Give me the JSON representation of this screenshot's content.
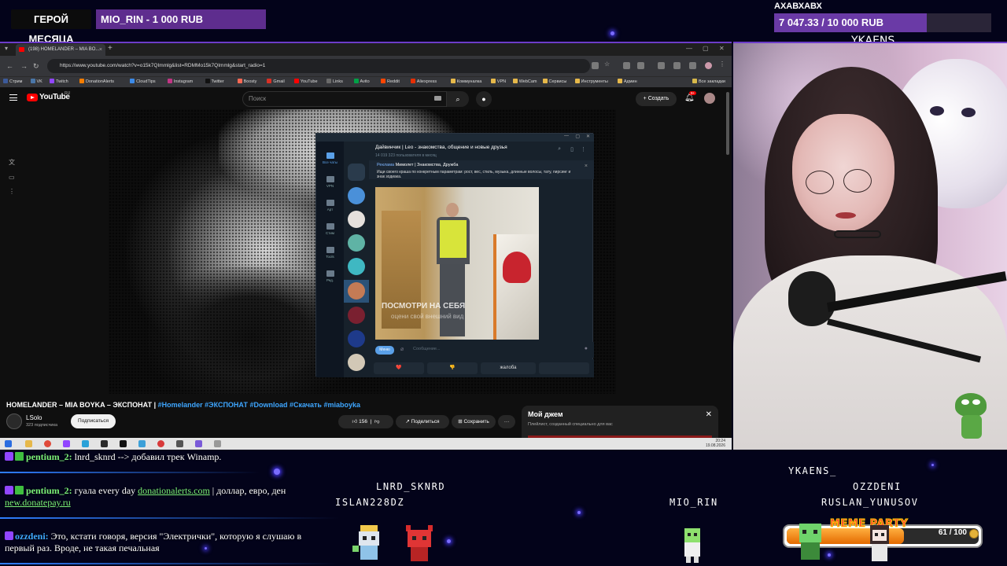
{
  "overlay": {
    "hero_label": "ГЕРОЙ МЕСЯЦА",
    "hero_value": "MIO_RIN - 1 000 RUB",
    "goal_title": "АХАВХАВХ",
    "goal_text": "7 047.33 / 10 000 RUB",
    "goal_progress": 0.7047,
    "streamer_name": "YKAENS",
    "accent_color": "#6c3cc9"
  },
  "browser": {
    "tab_title": "(198) HOMELANDER – MIA BO...",
    "url": "https://www.youtube.com/watch?v=o15k7QImmlg&list=RDMMo15k7QImmlg&start_radio=1",
    "bookmarks": [
      "Стрим",
      "VK",
      "Twitch",
      "DonationAlerts",
      "CloudTips",
      "Instagram",
      "Twitter",
      "Boosty",
      "Gmail",
      "YouTube",
      "Links",
      "Avito",
      "Reddit",
      "Aliexpress",
      "Коммуналка",
      "VPN",
      "WebCam",
      "Сервисы",
      "Инструменты",
      "Админ"
    ],
    "bookmarks_all": "Все закладки"
  },
  "youtube": {
    "logo": "YouTube",
    "region": "RU",
    "search_placeholder": "Поиск",
    "create_label": "Создать",
    "notifications_badge": "9+",
    "video_title_plain": "HOMELANDER – MIA BOYKA – ЭКСПОНАТ | ",
    "video_title_tags": "#Homelander #ЭКСПОНАТ #Download #Скачать #miaboyka",
    "channel_name": "LSolo",
    "channel_subs": "323 подписчика",
    "subscribe_label": "Подписаться",
    "likes": "156",
    "share_label": "Поделиться",
    "save_label": "Сохранить",
    "more_label": "···",
    "mix_title": "Мой джем",
    "mix_subtitle": "Плейлист, созданный специально для вас",
    "watermark": "LS"
  },
  "telegram": {
    "chat_title": "Дайвинчик | Leo - знакомства, общение и новые друзья",
    "chat_sub": "14 019 323 пользователя в месяц",
    "ad_prefix": "Реклама",
    "ad_title": "Мимолет | Знакомства, Дружба",
    "ad_body": "Ищи своего краша по конкретным параметрам: рост, вес, стиль, музыка, длинные волосы, тату, пирсинг и знак зодиака.",
    "folders": [
      {
        "label": "Все чаты",
        "badge": "99"
      },
      {
        "label": "VPN"
      },
      {
        "label": "Арт"
      },
      {
        "label": "Стим"
      },
      {
        "label": "Tools"
      },
      {
        "label": "Ред."
      }
    ],
    "photo_caption": "ПОСМОТРИ НА СЕБЯ",
    "photo_caption2": "оцени свой внешний вид",
    "menu_label": "Меню",
    "input_placeholder": "Сообщение...",
    "buttons": [
      "❤️",
      "👎",
      "жалоба",
      ""
    ]
  },
  "taskbar": {
    "time": "20:24",
    "date": "19.08.2026"
  },
  "chat": [
    {
      "user": "pentium_2:",
      "text": " lnrd_sknrd --> добавил трек Winamp."
    },
    {
      "user": "pentium_2:",
      "text": " гуала every day ",
      "link": "donationalerts.com",
      "text2": " | доллар, евро, ден",
      "link2": "new.donatepay.ru"
    },
    {
      "user": "ozzdeni:",
      "text": " Это, кстати говоря, версия \"Электрички\", которую я слушаю в первый раз. Вроде, не такая печальная"
    }
  ],
  "viewers": [
    "LNRD_SKNRD",
    "ISLAN228DZ",
    "MIO_RIN",
    "YKAENS_",
    "OZZDENI",
    "RUSLAN_YUNUSOV"
  ],
  "meme_party": {
    "label": "MEME PARTY",
    "count": "61 / 100",
    "progress": 0.61
  }
}
